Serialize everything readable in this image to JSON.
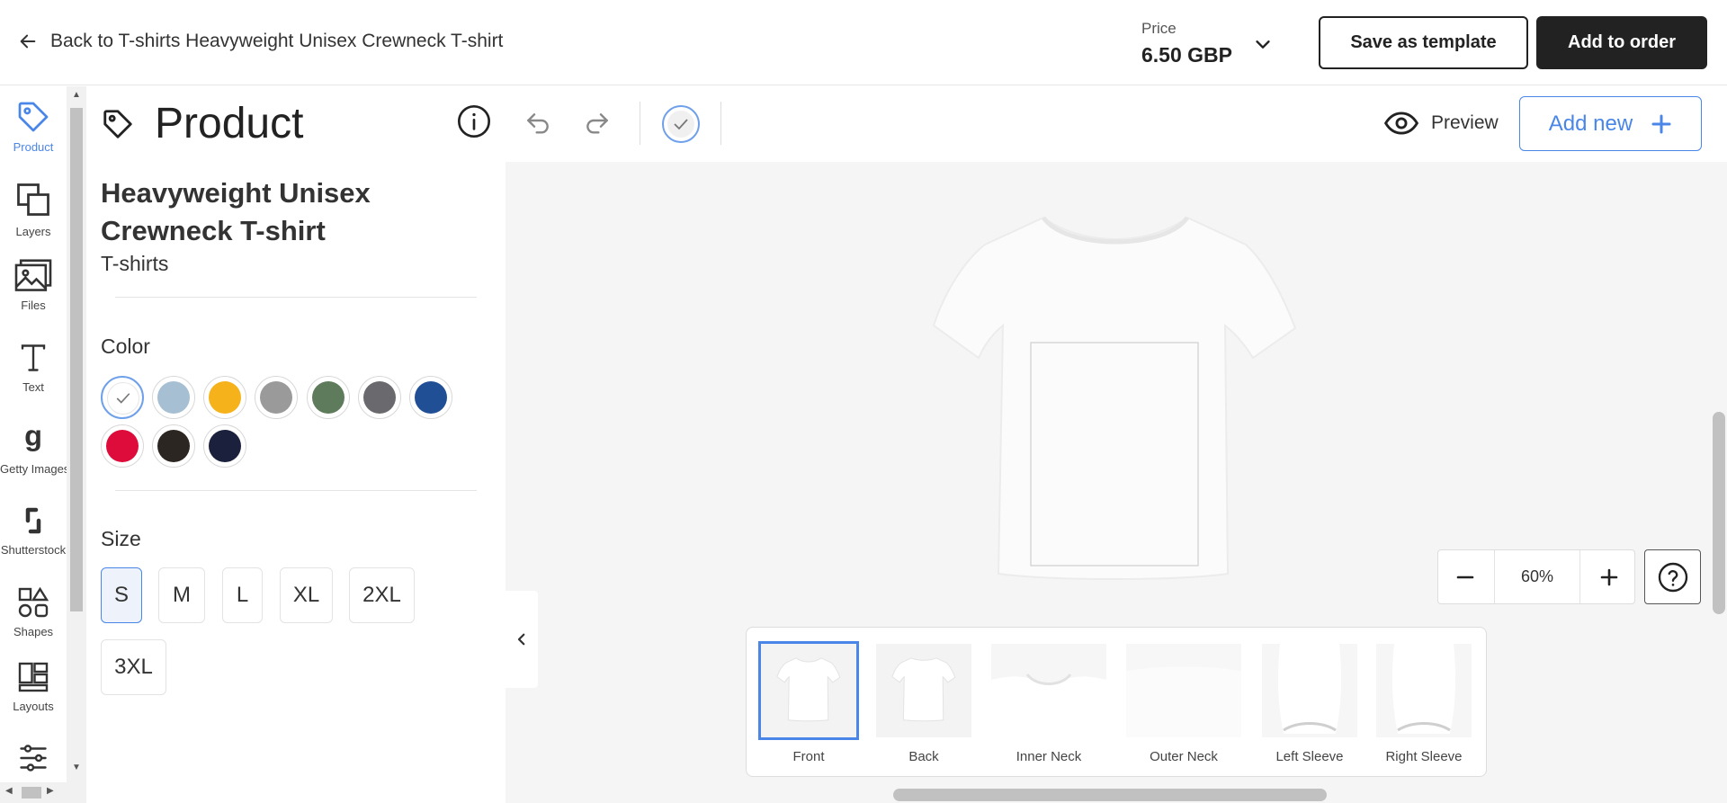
{
  "header": {
    "back_label": "Back to T-shirts Heavyweight Unisex Crewneck T-shirt",
    "price_label": "Price",
    "price_value": "6.50 GBP",
    "save_template_label": "Save as template",
    "add_to_order_label": "Add to order"
  },
  "nav": {
    "items": [
      {
        "label": "Product",
        "icon": "tag-icon",
        "active": true
      },
      {
        "label": "Layers",
        "icon": "layers-icon"
      },
      {
        "label": "Files",
        "icon": "image-icon"
      },
      {
        "label": "Text",
        "icon": "text-icon"
      },
      {
        "label": "Getty Images",
        "icon": "getty-icon"
      },
      {
        "label": "Shutterstock",
        "icon": "shutterstock-icon"
      },
      {
        "label": "Shapes",
        "icon": "shapes-icon"
      },
      {
        "label": "Layouts",
        "icon": "layouts-icon"
      },
      {
        "label": "",
        "icon": "sliders-icon"
      }
    ]
  },
  "panel": {
    "title": "Product",
    "product_name": "Heavyweight Unisex Crewneck T-shirt",
    "category": "T-shirts",
    "color_label": "Color",
    "colors": [
      {
        "name": "white",
        "hex": "#ffffff",
        "selected": true
      },
      {
        "name": "light-blue",
        "hex": "#a6bfd2"
      },
      {
        "name": "gold",
        "hex": "#f6b21b"
      },
      {
        "name": "heather-grey",
        "hex": "#9a9a9a"
      },
      {
        "name": "military-green",
        "hex": "#5e7b5b"
      },
      {
        "name": "charcoal",
        "hex": "#6a6a6e"
      },
      {
        "name": "royal-blue",
        "hex": "#214f96"
      },
      {
        "name": "red",
        "hex": "#de0c3a"
      },
      {
        "name": "black",
        "hex": "#2c2622"
      },
      {
        "name": "navy",
        "hex": "#1b213d"
      }
    ],
    "size_label": "Size",
    "sizes": [
      {
        "label": "S",
        "selected": true
      },
      {
        "label": "M"
      },
      {
        "label": "L"
      },
      {
        "label": "XL"
      },
      {
        "label": "2XL"
      },
      {
        "label": "3XL"
      }
    ]
  },
  "toolbar": {
    "preview_label": "Preview",
    "add_new_label": "Add new"
  },
  "zoom": {
    "value": "60%"
  },
  "views": [
    {
      "label": "Front",
      "selected": true
    },
    {
      "label": "Back"
    },
    {
      "label": "Inner Neck"
    },
    {
      "label": "Outer Neck"
    },
    {
      "label": "Left Sleeve"
    },
    {
      "label": "Right Sleeve"
    }
  ],
  "colors": {
    "accent": "#4a86e8",
    "dark_button": "#222222"
  }
}
